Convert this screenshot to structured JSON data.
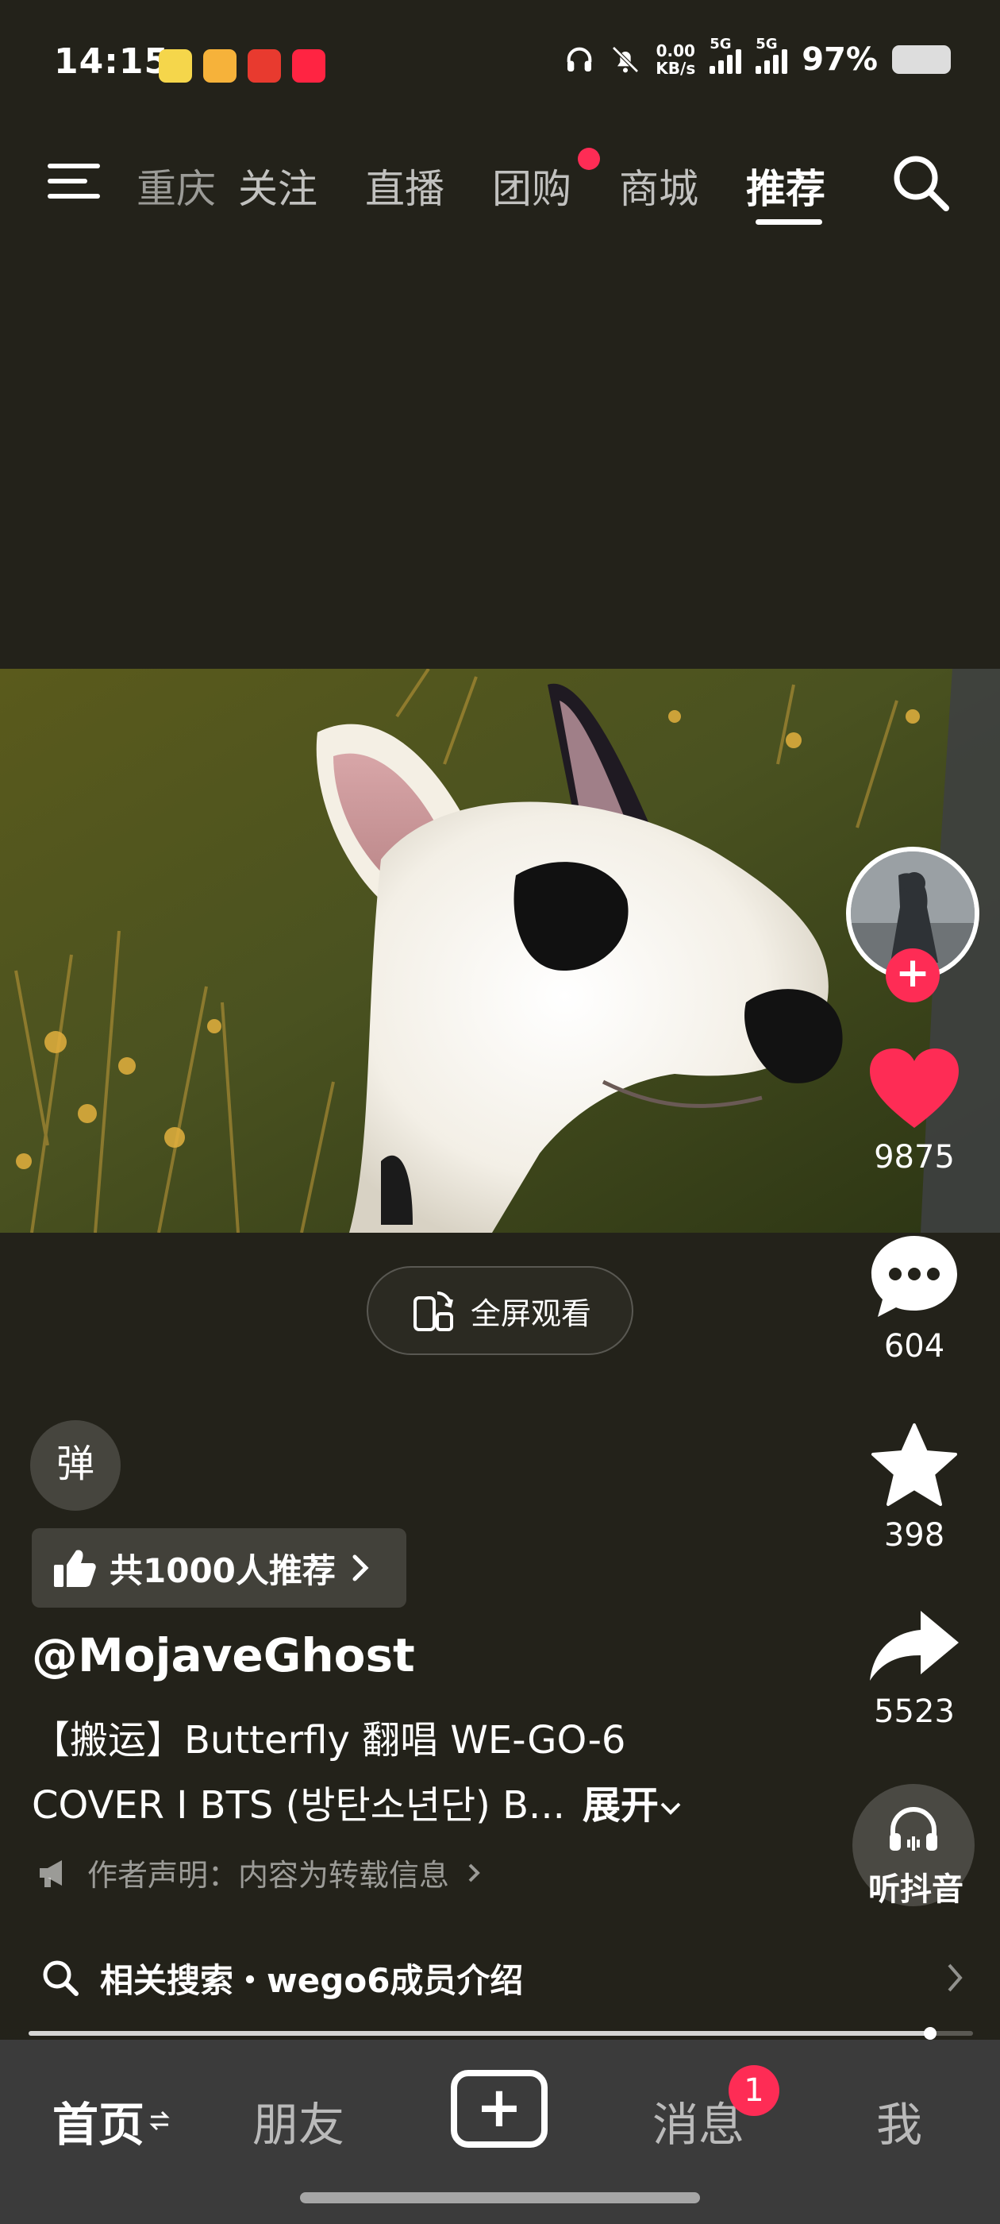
{
  "status_bar": {
    "time": "14:15",
    "net_speed_value": "0.00",
    "net_speed_unit": "KB/s",
    "signal1_label": "5G",
    "signal2_label": "5G",
    "battery": "97%"
  },
  "tabs": {
    "items": [
      "重庆",
      "关注",
      "直播",
      "团购",
      "商城",
      "推荐"
    ],
    "active": "推荐"
  },
  "video": {
    "fullscreen_label": "全屏观看"
  },
  "actions": {
    "likes": "9875",
    "comments": "604",
    "favorites": "398",
    "shares": "5523",
    "listen_label": "听抖音"
  },
  "info": {
    "danmu_label": "弹",
    "recommend_label": "共1000人推荐",
    "author": "@MojaveGhost",
    "desc_line1": "【搬运】Butterfly 翻唱 WE-GO-6",
    "desc_line2": "COVER I BTS (방탄소년단) B...",
    "expand_label": "展开",
    "statement": "作者声明：内容为转载信息"
  },
  "related": {
    "label": "相关搜索・wego6成员介绍"
  },
  "video_progress": 0.96,
  "bottom_nav": {
    "home": "首页",
    "friends": "朋友",
    "messages": "消息",
    "messages_badge": "1",
    "me": "我"
  },
  "colors": {
    "background": "#23221a",
    "accent_red": "#fe2c55",
    "nav_bg": "#3b3b3b"
  }
}
